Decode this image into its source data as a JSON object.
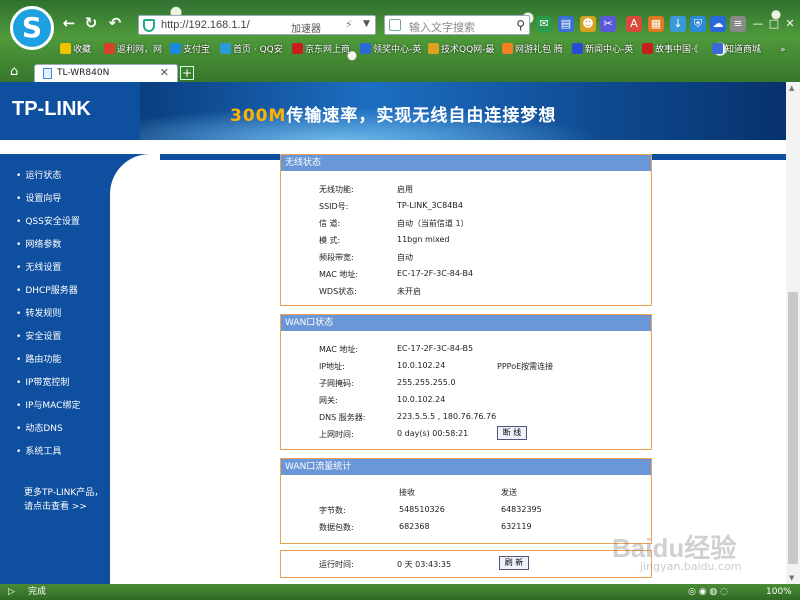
{
  "browser": {
    "url": "http://192.168.1.1/",
    "accelerator": "加速器",
    "search_placeholder": "输入文字搜索",
    "bookmarks": [
      "收藏",
      "返利网，网",
      "支付宝",
      "首页 · QQ安",
      "京东网上商",
      "领奖中心-英",
      "技术QQ网-最",
      "网游礼包 腾",
      "新闻中心-英",
      "故事中国·《",
      "知道商城"
    ],
    "tab_title": "TL-WR840N",
    "status_left": "完成",
    "zoom": "100%"
  },
  "colors": {
    "brand_blue": "#0f4fa0",
    "panel_header": "#6a97d8",
    "panel_border": "#f0a050"
  },
  "banner": {
    "logo": "TP-LINK",
    "slogan_highlight": "300M",
    "slogan_rest": "传输速率，实现无线自由连接梦想"
  },
  "menu": [
    "运行状态",
    "设置向导",
    "QSS安全设置",
    "网络参数",
    "无线设置",
    "DHCP服务器",
    "转发规则",
    "安全设置",
    "路由功能",
    "IP带宽控制",
    "IP与MAC绑定",
    "动态DNS",
    "系统工具"
  ],
  "more": {
    "line1": "更多TP-LINK产品，",
    "line2": "请点击查看 >>"
  },
  "wireless": {
    "title": "无线状态",
    "rows": [
      {
        "label": "无线功能:",
        "value": "启用"
      },
      {
        "label": "SSID号:",
        "value": "TP-LINK_3C84B4"
      },
      {
        "label": "信 道:",
        "value": "自动（当前信道 1）"
      },
      {
        "label": "模 式:",
        "value": "11bgn mixed"
      },
      {
        "label": "频段带宽:",
        "value": "自动"
      },
      {
        "label": "MAC 地址:",
        "value": "EC-17-2F-3C-84-B4"
      },
      {
        "label": "WDS状态:",
        "value": "未开启"
      }
    ]
  },
  "wan": {
    "title": "WAN口状态",
    "rows": [
      {
        "label": "MAC 地址:",
        "value": "EC-17-2F-3C-84-B5"
      },
      {
        "label": "IP地址:",
        "value": "10.0.102.24"
      },
      {
        "label": "子网掩码:",
        "value": "255.255.255.0"
      },
      {
        "label": "网关:",
        "value": "10.0.102.24"
      },
      {
        "label": "DNS 服务器:",
        "value": "223.5.5.5 , 180.76.76.76"
      },
      {
        "label": "上网时间:",
        "value": "0 day(s) 00:58:21"
      }
    ],
    "conn_type": "PPPoE按需连接",
    "disconnect_label": "断 线"
  },
  "traffic": {
    "title": "WAN口流量统计",
    "col_recv": "接收",
    "col_send": "发送",
    "rows": [
      {
        "label": "字节数:",
        "recv": "548510326",
        "send": "64832395"
      },
      {
        "label": "数据包数:",
        "recv": "682368",
        "send": "632119"
      }
    ]
  },
  "runtime": {
    "label": "运行时间:",
    "value": "0 天 03:43:35",
    "refresh_label": "刷 新"
  },
  "watermark": {
    "line1": "Baidu经验",
    "line2": "jingyan.baidu.com"
  }
}
